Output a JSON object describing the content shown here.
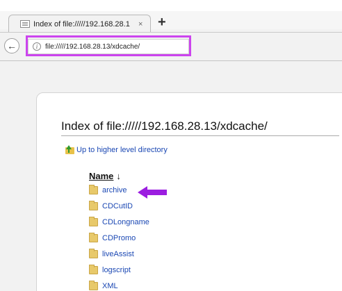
{
  "browser": {
    "tab_title": "Index of file://///192.168.28.1",
    "tab_close": "×",
    "new_tab": "+",
    "back": "←",
    "info": "i",
    "url": "file://///192.168.28.13/xdcache/"
  },
  "page": {
    "heading": "Index of file://///192.168.28.13/xdcache/",
    "up_link": "Up to higher level directory",
    "name_header": "Name",
    "sort_arrow": "↓",
    "items": [
      {
        "label": "archive"
      },
      {
        "label": "CDCutID"
      },
      {
        "label": "CDLongname"
      },
      {
        "label": "CDPromo"
      },
      {
        "label": "liveAssist"
      },
      {
        "label": "logscript"
      },
      {
        "label": "XML"
      }
    ]
  },
  "annotations": {
    "highlight_color": "#cc44ee",
    "arrow_color": "#9b1de0"
  }
}
